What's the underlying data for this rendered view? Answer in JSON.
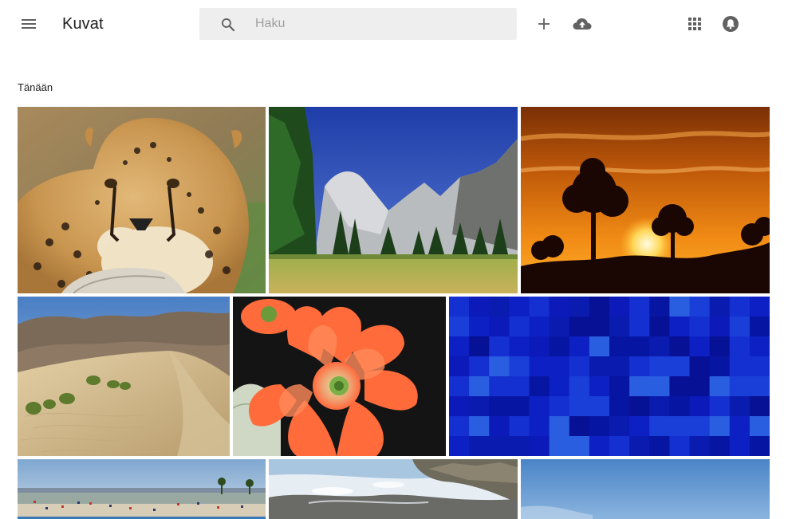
{
  "app": {
    "title": "Kuvat"
  },
  "search": {
    "placeholder": "Haku"
  },
  "toolbar": {
    "icons": [
      "menu-icon",
      "search-icon",
      "add-icon",
      "cloud-upload-icon",
      "apps-grid-icon",
      "notifications-icon"
    ]
  },
  "section": {
    "label": "Tänään"
  },
  "photos": [
    {
      "subject": "cheetah"
    },
    {
      "subject": "mountain-valley"
    },
    {
      "subject": "sunset-tree"
    },
    {
      "subject": "sand-dunes"
    },
    {
      "subject": "cactus-flower"
    },
    {
      "subject": "blue-mosaic"
    },
    {
      "subject": "beach-crowd"
    },
    {
      "subject": "rocky-shore"
    },
    {
      "subject": "blue-sky"
    }
  ],
  "colors": {
    "search_bg": "#eeeeee",
    "icon_gray": "#616161",
    "text": "#212121",
    "placeholder": "#9e9e9e"
  }
}
